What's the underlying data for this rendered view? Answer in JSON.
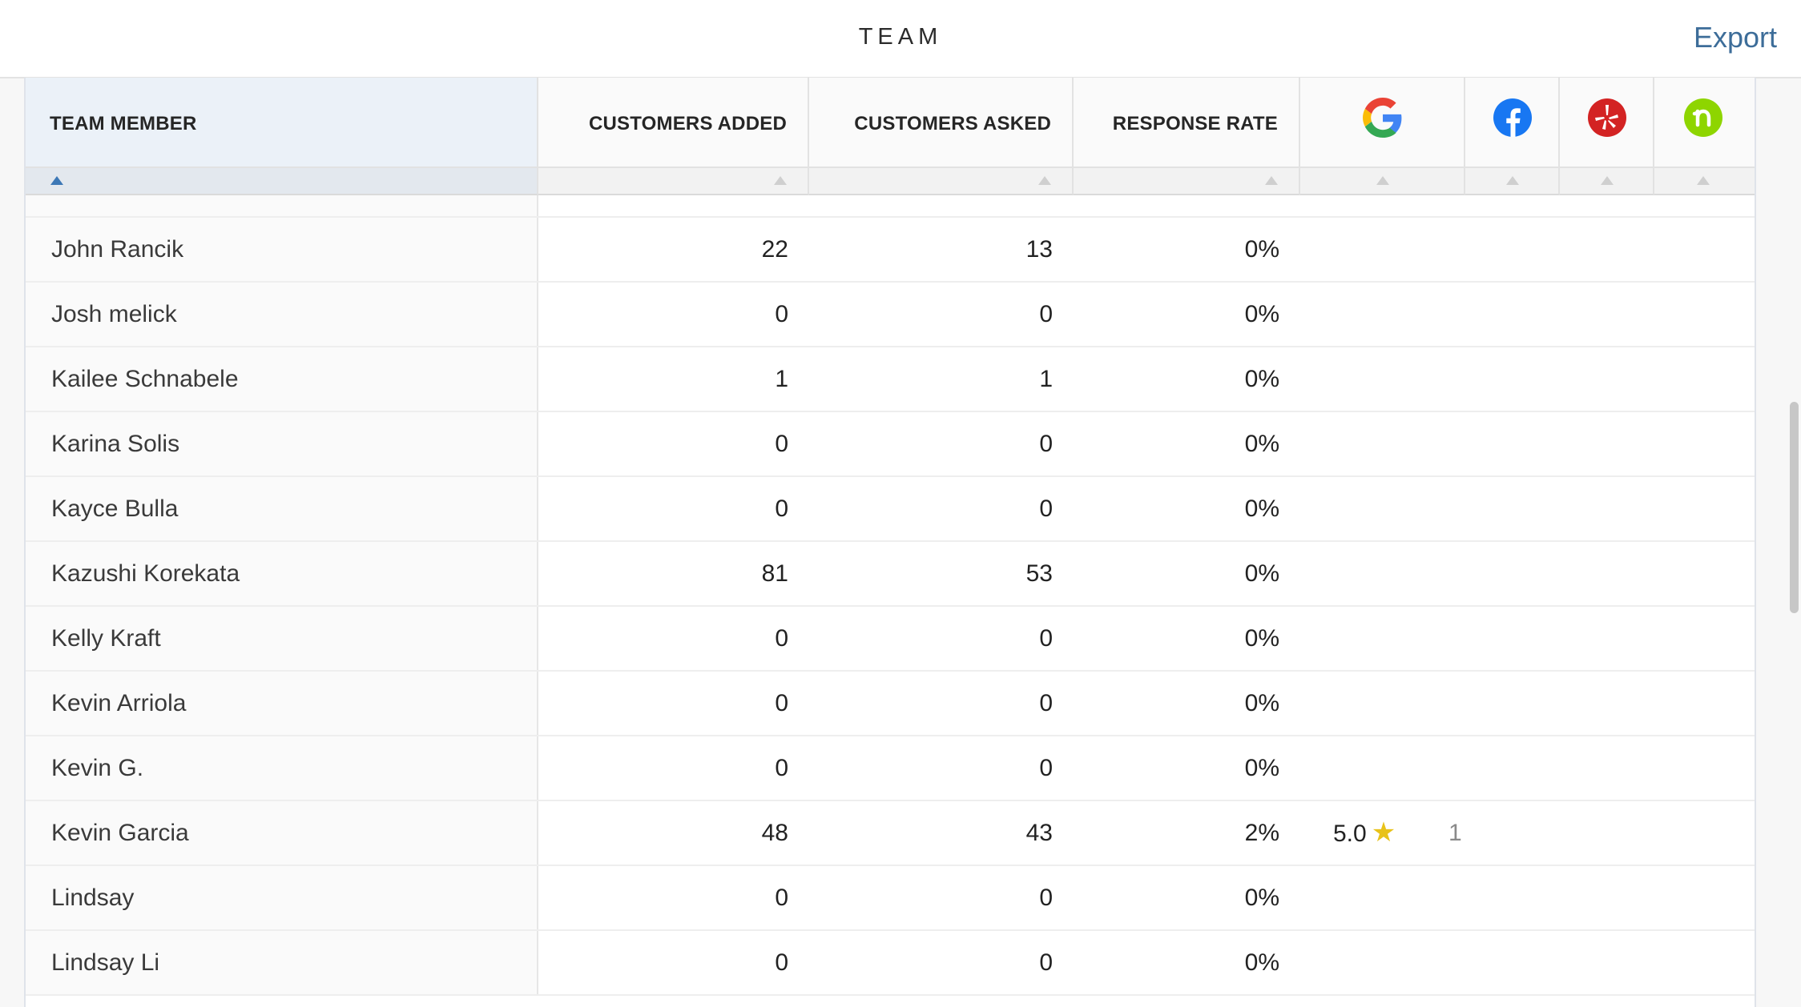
{
  "header": {
    "title": "TEAM",
    "export_label": "Export"
  },
  "columns": {
    "team_member": "TEAM MEMBER",
    "customers_added": "CUSTOMERS ADDED",
    "customers_asked": "CUSTOMERS ASKED",
    "response_rate": "RESPONSE RATE",
    "icons": [
      "google-icon",
      "facebook-icon",
      "yelp-icon",
      "nextdoor-icon"
    ]
  },
  "sort": {
    "column": "team_member",
    "direction": "ascending"
  },
  "colors": {
    "accent": "#3d6d99",
    "google_blue": "#4285F4",
    "facebook": "#1877F2",
    "yelp": "#D32323",
    "nextdoor": "#8ED500",
    "star": "#E8C21A"
  },
  "rows": [
    {
      "name": "John Rancik",
      "added": "22",
      "asked": "13",
      "rate": "0%"
    },
    {
      "name": "Josh melick",
      "added": "0",
      "asked": "0",
      "rate": "0%"
    },
    {
      "name": "Kailee Schnabele",
      "added": "1",
      "asked": "1",
      "rate": "0%"
    },
    {
      "name": "Karina Solis",
      "added": "0",
      "asked": "0",
      "rate": "0%"
    },
    {
      "name": "Kayce Bulla",
      "added": "0",
      "asked": "0",
      "rate": "0%"
    },
    {
      "name": "Kazushi Korekata",
      "added": "81",
      "asked": "53",
      "rate": "0%"
    },
    {
      "name": "Kelly Kraft",
      "added": "0",
      "asked": "0",
      "rate": "0%"
    },
    {
      "name": "Kevin Arriola",
      "added": "0",
      "asked": "0",
      "rate": "0%"
    },
    {
      "name": "Kevin G.",
      "added": "0",
      "asked": "0",
      "rate": "0%"
    },
    {
      "name": "Kevin Garcia",
      "added": "48",
      "asked": "43",
      "rate": "2%",
      "google_rating": "5.0",
      "google_count": "1"
    },
    {
      "name": "Lindsay",
      "added": "0",
      "asked": "0",
      "rate": "0%"
    },
    {
      "name": "Lindsay Li",
      "added": "0",
      "asked": "0",
      "rate": "0%"
    }
  ]
}
